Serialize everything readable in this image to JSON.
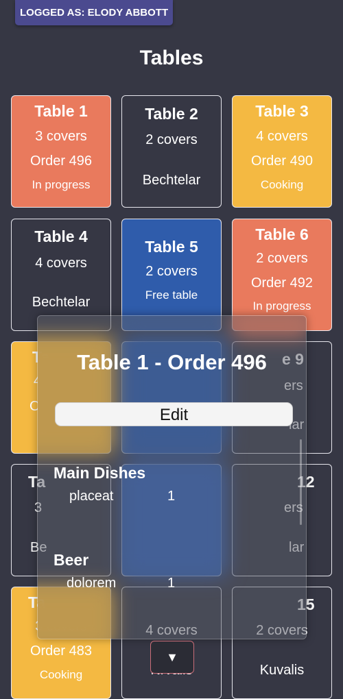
{
  "header": {
    "logged_as": "LOGGED AS: ELODY ABBOTT"
  },
  "page": {
    "title": "Tables"
  },
  "tables": [
    {
      "name": "Table 1",
      "covers": "3 covers",
      "order": "Order 496",
      "status": "In progress",
      "color": "#e97a5d"
    },
    {
      "name": "Table 2",
      "covers": "2 covers",
      "waiter": "Bechtelar",
      "color": "#363744"
    },
    {
      "name": "Table 3",
      "covers": "4 covers",
      "order": "Order 490",
      "status": "Cooking",
      "color": "#f4b942"
    },
    {
      "name": "Table 4",
      "covers": "4 covers",
      "waiter": "Bechtelar",
      "color": "#363744"
    },
    {
      "name": "Table 5",
      "covers": "2 covers",
      "status": "Free table",
      "color": "#2f5cab"
    },
    {
      "name": "Table 6",
      "covers": "2 covers",
      "order": "Order 492",
      "status": "In progress",
      "color": "#e97a5d"
    },
    {
      "name_partial": "Ta",
      "covers_partial": "4",
      "order_partial": "Or",
      "status_partial": "C",
      "color": "#f4b942"
    },
    {
      "name_partial": "e 9",
      "covers_partial": "ers",
      "waiter_partial": "lar",
      "color": "#363744"
    },
    {
      "name_partial": "Ta",
      "covers_partial": "3",
      "waiter_partial": "Be",
      "color": "#363744"
    },
    {
      "name_partial": "12",
      "covers_partial": "ers",
      "waiter_partial": "lar",
      "color": "#363744"
    },
    {
      "name_partial": "Ta",
      "covers": "3 covers",
      "order": "Order 483",
      "status": "Cooking",
      "color": "#f4b942"
    },
    {
      "covers": "4 covers",
      "waiter_partial": "Nrvalis",
      "color": "#363744"
    },
    {
      "name_partial": "15",
      "covers": "2 covers",
      "waiter": "Kuvalis",
      "color": "#363744"
    }
  ],
  "order_popup": {
    "title": "Table 1 - Order 496",
    "edit_label": "Edit",
    "categories": [
      {
        "name": "Main Dishes",
        "items": [
          {
            "name": "placeat",
            "qty": "1"
          }
        ]
      },
      {
        "name": "Beer",
        "items": [
          {
            "name": "dolorem",
            "qty": "1"
          }
        ]
      }
    ]
  },
  "toggle": {
    "icon": "chevron-down-icon",
    "glyph": "▼"
  }
}
